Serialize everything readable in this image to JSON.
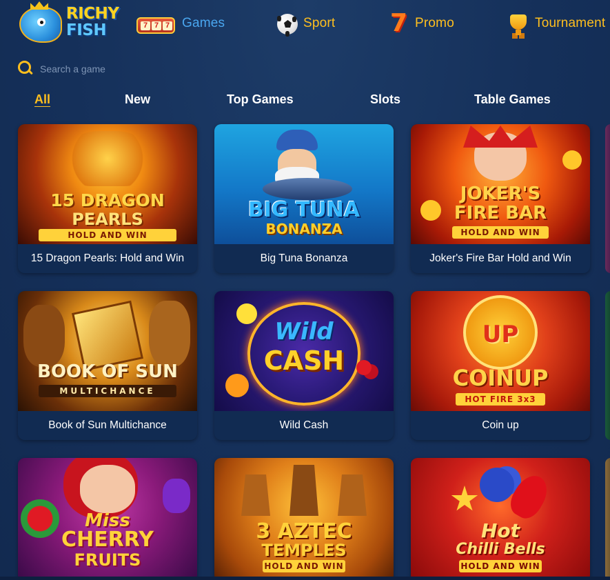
{
  "brand": {
    "line1": "RICHY",
    "line2": "FISH"
  },
  "nav": [
    {
      "label": "Games",
      "icon": "slot-machine-icon"
    },
    {
      "label": "Sport",
      "icon": "soccer-ball-icon"
    },
    {
      "label": "Promo",
      "icon": "lucky-seven-icon"
    },
    {
      "label": "Tournament",
      "icon": "trophy-icon"
    }
  ],
  "search": {
    "placeholder": "Search a game",
    "value": ""
  },
  "categories": [
    {
      "label": "All",
      "active": true
    },
    {
      "label": "New",
      "active": false
    },
    {
      "label": "Top Games",
      "active": false
    },
    {
      "label": "Slots",
      "active": false
    },
    {
      "label": "Table Games",
      "active": false
    }
  ],
  "games": [
    {
      "title": "15 Dragon Pearls: Hold and Win",
      "art": [
        "15 DRAGON",
        "PEARLS"
      ],
      "tag": "HOLD AND WIN"
    },
    {
      "title": "Big Tuna Bonanza",
      "art": [
        "BIG TUNA",
        "BONANZA"
      ],
      "tag": ""
    },
    {
      "title": "Joker's Fire Bar Hold and Win",
      "art": [
        "JOKER'S",
        "FIRE BAR"
      ],
      "tag": "HOLD AND WIN"
    },
    {
      "title": "Book of Sun Multichance",
      "art": [
        "BOOK OF SUN"
      ],
      "tag": "MULTICHANCE"
    },
    {
      "title": "Wild Cash",
      "art": [
        "Wild",
        "CASH"
      ],
      "tag": ""
    },
    {
      "title": "Coin up",
      "art": [
        "UP",
        "COINUP"
      ],
      "tag": "HOT FIRE 3x3"
    },
    {
      "title": "",
      "art": [
        "Miss",
        "CHERRY",
        "FRUITS"
      ],
      "tag": ""
    },
    {
      "title": "",
      "art": [
        "3 AZTEC",
        "TEMPLES"
      ],
      "tag": "HOLD AND WIN"
    },
    {
      "title": "",
      "art": [
        "Hot",
        "Chilli Bells"
      ],
      "tag": "HOLD AND WIN"
    }
  ],
  "colors": {
    "background": "#17325a",
    "accent": "#ffbf1e",
    "link": "#4aa7f0",
    "card": "#112b52"
  }
}
